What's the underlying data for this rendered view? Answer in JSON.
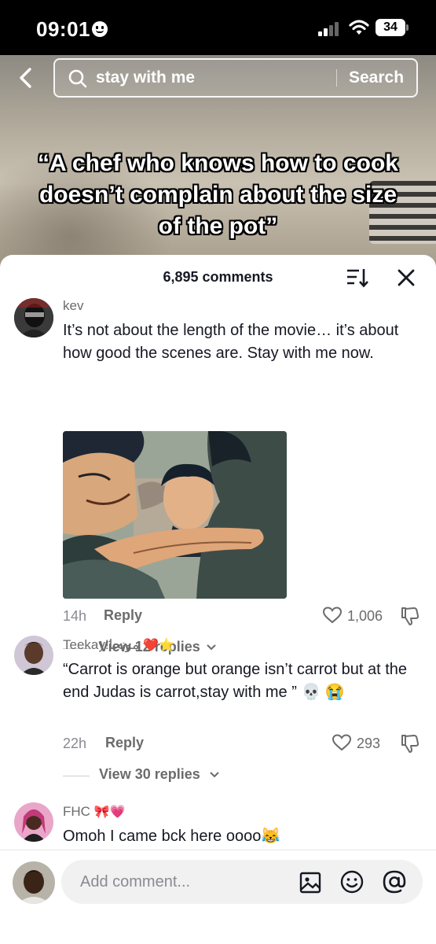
{
  "status_bar": {
    "time": "09:01",
    "battery": "34"
  },
  "search": {
    "query": "stay with me",
    "button_label": "Search"
  },
  "video": {
    "caption": "“A chef who knows how to cook doesn’t complain about the size of the pot”"
  },
  "comments_header": {
    "count_label": "6,895 comments"
  },
  "comments": [
    {
      "username": "kev",
      "username_emoji": "",
      "text": "It’s not about the length of the movie… it’s about how good the scenes are. Stay with me now.",
      "time": "14h",
      "reply_label": "Reply",
      "likes": "1,006",
      "view_replies": "View 12 replies"
    },
    {
      "username": "Teekay!مونجا",
      "username_emoji": "❤️⭐",
      "text": "“Carrot is orange but orange isn’t carrot but at the end Judas is carrot,stay with me ” 💀 😭",
      "time": "22h",
      "reply_label": "Reply",
      "likes": "293",
      "view_replies": "View 30 replies"
    },
    {
      "username": "FHC",
      "username_emoji": "🎀💗",
      "text": "Omoh I came bck here oooo😹"
    }
  ],
  "composer": {
    "placeholder": "Add comment..."
  },
  "icons": [
    "back-icon",
    "search-icon",
    "sort-icon",
    "close-icon",
    "heart-icon",
    "dislike-icon",
    "chevron-down-icon",
    "image-icon",
    "emoji-icon",
    "mention-icon"
  ],
  "colors": {
    "text": "#161823",
    "secondary": "#6b6b6b",
    "muted": "#8a8b91",
    "field": "#f1f1f2"
  }
}
